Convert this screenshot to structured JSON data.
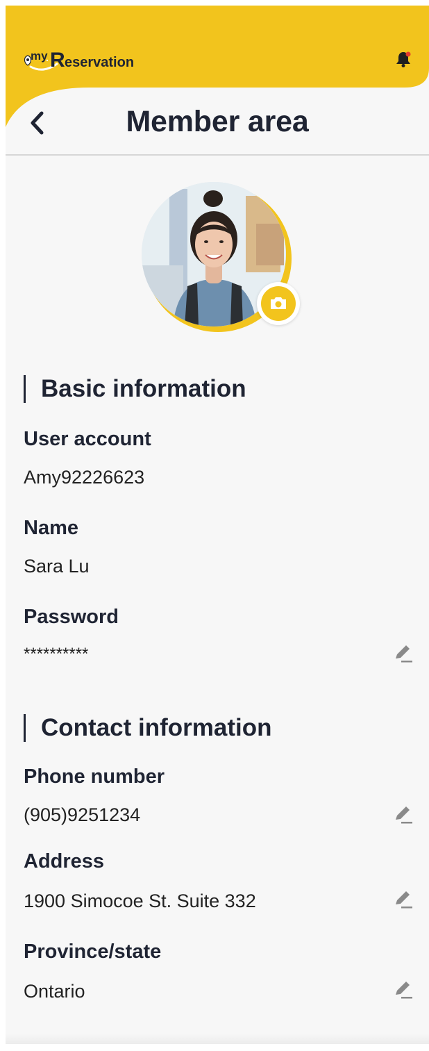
{
  "app": {
    "logo_text": "myReservation",
    "brand_color": "#F2C41D"
  },
  "header": {
    "title": "Member area",
    "back_icon": "chevron-left-icon",
    "notification_icon": "bell-icon"
  },
  "profile": {
    "avatar_alt": "profile photo",
    "camera_icon": "camera-icon"
  },
  "basic": {
    "title": "Basic information",
    "user_account_label": "User account",
    "user_account_value": "Amy92226623",
    "name_label": "Name",
    "name_value": "Sara Lu",
    "password_label": "Password",
    "password_value": "**********"
  },
  "contact": {
    "title": "Contact information",
    "phone_label": "Phone number",
    "phone_value": "(905)9251234",
    "address_label": "Address",
    "address_value": "1900 Simocoe St. Suite 332",
    "province_label": "Province/state",
    "province_value": "Ontario"
  },
  "icons": {
    "edit": "pencil-edit-icon"
  }
}
